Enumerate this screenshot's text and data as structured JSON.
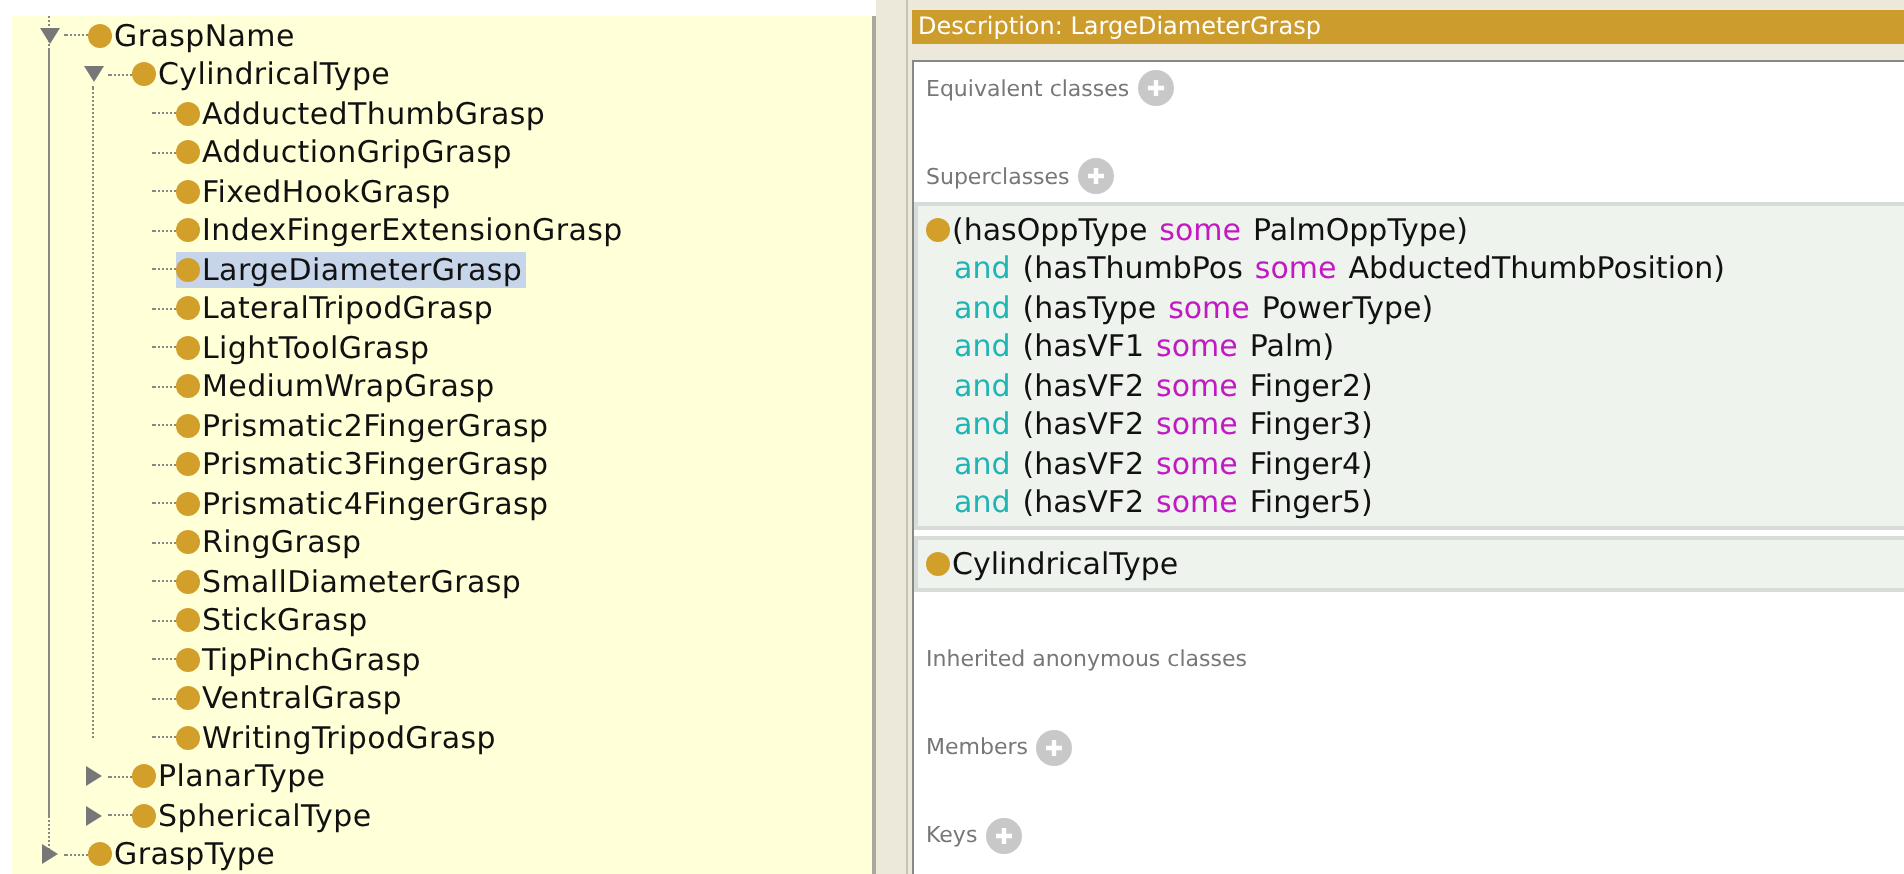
{
  "tree": [
    {
      "label": "GraspName",
      "expanded": true,
      "selected": false,
      "children": [
        {
          "label": "CylindricalType",
          "expanded": true,
          "selected": false,
          "children": [
            {
              "label": "AdductedThumbGrasp",
              "selected": false
            },
            {
              "label": "AdductionGripGrasp",
              "selected": false
            },
            {
              "label": "FixedHookGrasp",
              "selected": false
            },
            {
              "label": "IndexFingerExtensionGrasp",
              "selected": false
            },
            {
              "label": "LargeDiameterGrasp",
              "selected": true
            },
            {
              "label": "LateralTripodGrasp",
              "selected": false
            },
            {
              "label": "LightToolGrasp",
              "selected": false
            },
            {
              "label": "MediumWrapGrasp",
              "selected": false
            },
            {
              "label": "Prismatic2FingerGrasp",
              "selected": false
            },
            {
              "label": "Prismatic3FingerGrasp",
              "selected": false
            },
            {
              "label": "Prismatic4FingerGrasp",
              "selected": false
            },
            {
              "label": "RingGrasp",
              "selected": false
            },
            {
              "label": "SmallDiameterGrasp",
              "selected": false
            },
            {
              "label": "StickGrasp",
              "selected": false
            },
            {
              "label": "TipPinchGrasp",
              "selected": false
            },
            {
              "label": "VentralGrasp",
              "selected": false
            },
            {
              "label": "WritingTripodGrasp",
              "selected": false
            }
          ]
        },
        {
          "label": "PlanarType",
          "expanded": false,
          "selected": false
        },
        {
          "label": "SphericalType",
          "expanded": false,
          "selected": false
        }
      ]
    },
    {
      "label": "GraspType",
      "expanded": false,
      "selected": false
    }
  ],
  "description": {
    "title": "Description: LargeDiameterGrasp",
    "sections": [
      {
        "kind": "add",
        "label": "Equivalent classes"
      },
      {
        "kind": "add",
        "label": "Superclasses",
        "entries": [
          {
            "lines": [
              [
                {
                  "kind": "text",
                  "text": "(hasOppType"
                },
                {
                  "kind": "some",
                  "text": "some"
                },
                {
                  "kind": "text",
                  "text": "PalmOppType)"
                }
              ],
              [
                {
                  "kind": "and",
                  "text": "and"
                },
                {
                  "kind": "text",
                  "text": "(hasThumbPos"
                },
                {
                  "kind": "some",
                  "text": "some"
                },
                {
                  "kind": "text",
                  "text": "AbductedThumbPosition)"
                }
              ],
              [
                {
                  "kind": "and",
                  "text": "and"
                },
                {
                  "kind": "text",
                  "text": "(hasType"
                },
                {
                  "kind": "some",
                  "text": "some"
                },
                {
                  "kind": "text",
                  "text": "PowerType)"
                }
              ],
              [
                {
                  "kind": "and",
                  "text": "and"
                },
                {
                  "kind": "text",
                  "text": "(hasVF1"
                },
                {
                  "kind": "some",
                  "text": "some"
                },
                {
                  "kind": "text",
                  "text": "Palm)"
                }
              ],
              [
                {
                  "kind": "and",
                  "text": "and"
                },
                {
                  "kind": "text",
                  "text": "(hasVF2"
                },
                {
                  "kind": "some",
                  "text": "some"
                },
                {
                  "kind": "text",
                  "text": "Finger2)"
                }
              ],
              [
                {
                  "kind": "and",
                  "text": "and"
                },
                {
                  "kind": "text",
                  "text": "(hasVF2"
                },
                {
                  "kind": "some",
                  "text": "some"
                },
                {
                  "kind": "text",
                  "text": "Finger3)"
                }
              ],
              [
                {
                  "kind": "and",
                  "text": "and"
                },
                {
                  "kind": "text",
                  "text": "(hasVF2"
                },
                {
                  "kind": "some",
                  "text": "some"
                },
                {
                  "kind": "text",
                  "text": "Finger4)"
                }
              ],
              [
                {
                  "kind": "and",
                  "text": "and"
                },
                {
                  "kind": "text",
                  "text": "(hasVF2"
                },
                {
                  "kind": "some",
                  "text": "some"
                },
                {
                  "kind": "text",
                  "text": "Finger5)"
                }
              ]
            ]
          },
          {
            "lines": [
              [
                {
                  "kind": "text",
                  "text": "CylindricalType"
                }
              ]
            ]
          }
        ]
      },
      {
        "kind": "plain",
        "label": "Inherited anonymous classes"
      },
      {
        "kind": "add",
        "label": "Members"
      },
      {
        "kind": "add",
        "label": "Keys"
      }
    ]
  }
}
